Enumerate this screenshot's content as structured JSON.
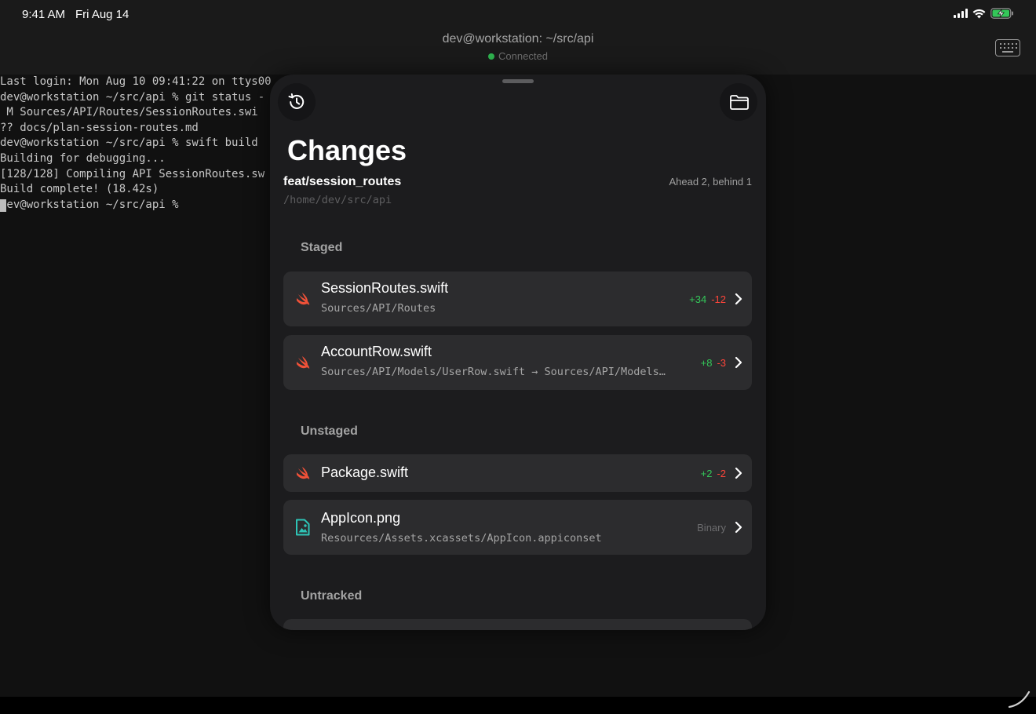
{
  "status_bar": {
    "time": "9:41 AM",
    "date": "Fri Aug 14"
  },
  "terminal": {
    "title": "dev@workstation: ~/src/api",
    "connection": "Connected",
    "connection_color": "#2fb44f",
    "lines": [
      "Last login: Mon Aug 10 09:41:22 on ttys00",
      "dev@workstation ~/src/api % git status -",
      " M Sources/API/Routes/SessionRoutes.swi",
      "?? docs/plan-session-routes.md",
      "dev@workstation ~/src/api % swift build",
      "Building for debugging...",
      "[128/128] Compiling API SessionRoutes.sw",
      "Build complete! (18.42s)"
    ],
    "prompt": "dev@workstation ~/src/api %"
  },
  "sheet": {
    "history_icon": "history-icon",
    "folder_icon": "folder-icon",
    "title": "Changes",
    "branch": "feat/session_routes",
    "ahead_behind": "Ahead 2, behind 1",
    "repo_path": "/home/dev/src/api",
    "sections": {
      "staged": {
        "label": "Staged",
        "items": [
          {
            "name": "SessionRoutes.swift",
            "path": "Sources/API/Routes",
            "additions": "+34",
            "deletions": "-12",
            "icon": "swift-icon"
          },
          {
            "name": "AccountRow.swift",
            "path": "Sources/API/Models/UserRow.swift → Sources/API/Models/AccountRow.swift",
            "additions": "+8",
            "deletions": "-3",
            "icon": "swift-icon"
          }
        ]
      },
      "unstaged": {
        "label": "Unstaged",
        "items": [
          {
            "name": "Package.swift",
            "additions": "+2",
            "deletions": "-2",
            "icon": "swift-icon"
          },
          {
            "name": "AppIcon.png",
            "path": "Resources/Assets.xcassets/AppIcon.appiconset",
            "binary": "Binary",
            "icon": "image-file-icon"
          }
        ]
      },
      "untracked": {
        "label": "Untracked"
      }
    },
    "colors": {
      "additions": "#34c759",
      "deletions": "#ff453a",
      "swift": "#f05138",
      "image": "#2ec4b6"
    }
  }
}
